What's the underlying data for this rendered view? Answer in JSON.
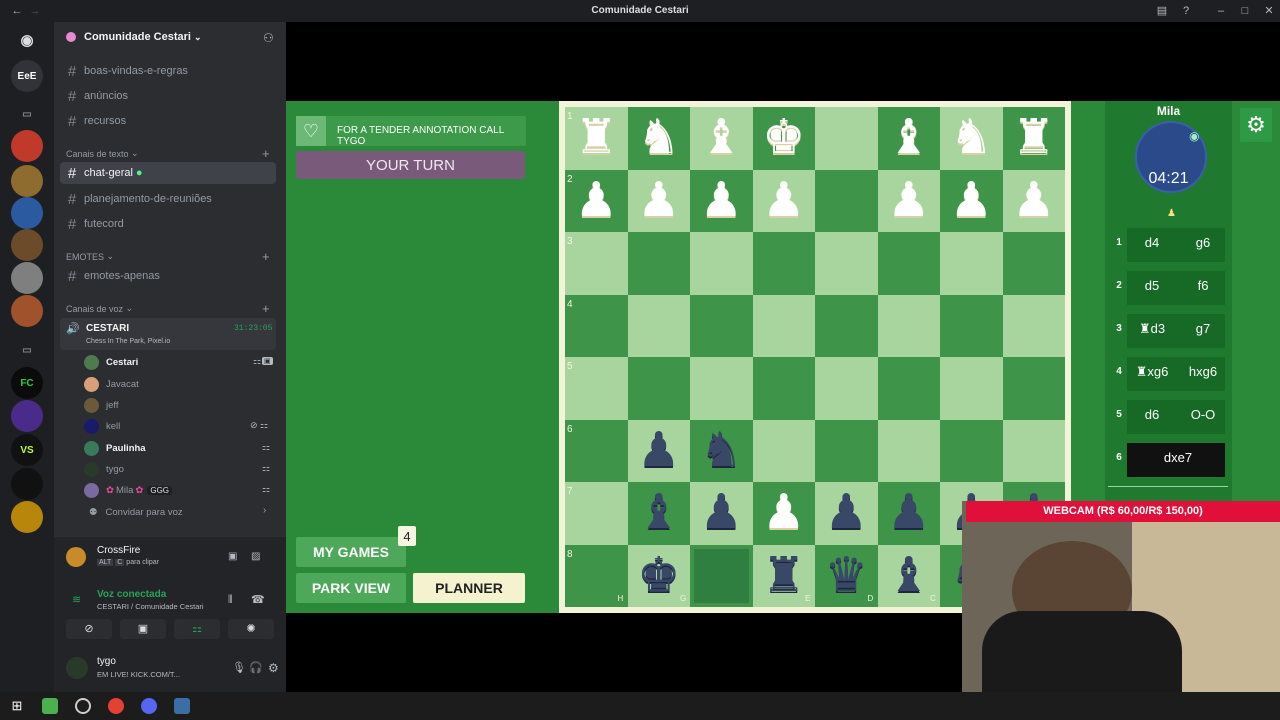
{
  "window": {
    "title": "Comunidade Cestari"
  },
  "rail": {
    "servers": [
      "EeE",
      "FC",
      "VS"
    ]
  },
  "server": {
    "name": "Comunidade Cestari"
  },
  "channels": {
    "top": [
      "boas-vindas-e-regras",
      "anúncios",
      "recursos"
    ],
    "text_category": "Canais de texto",
    "text": [
      "chat-geral",
      "planejamento-de-reuniões",
      "futecord"
    ],
    "emotes_category": "EMOTES",
    "emotes": [
      "emotes-apenas"
    ],
    "voice_category": "Canais de voz",
    "voice_channel": "CESTARI",
    "voice_timer": "31:23:05",
    "voice_activity": "Chess In The Park, Pixel.io",
    "voice_users": [
      "Cestari",
      "Javacat",
      "jeff",
      "kell",
      "Paulinha",
      "tygo",
      "Mila",
      "GGG"
    ],
    "invite": "Convidar para voz"
  },
  "activity": {
    "name": "CrossFire",
    "hint_alt": "ALT",
    "hint_key": "C",
    "hint_text": "para clipar"
  },
  "voice": {
    "status": "Voz conectada",
    "where": "CESTARI / Comunidade Cestari"
  },
  "user": {
    "name": "tygo",
    "status": "EM LIVE! KICK.COM/T..."
  },
  "game": {
    "banner": "FOR A TENDER ANNOTATION CALL TYGO",
    "turn": "YOUR TURN",
    "my_games": "MY GAMES",
    "games_count": "4",
    "park_view": "PARK VIEW",
    "planner": "PLANNER",
    "opponent": "Mila",
    "clock": "04:21",
    "ranks": [
      "1",
      "2",
      "3",
      "4",
      "5",
      "6",
      "7",
      "8"
    ],
    "files": [
      "H",
      "G",
      "F",
      "E",
      "D",
      "C"
    ],
    "moves": [
      {
        "n": "1",
        "w": "d4",
        "b": "g6"
      },
      {
        "n": "2",
        "w": "d5",
        "b": "f6"
      },
      {
        "n": "3",
        "w": "♜d3",
        "b": "g7"
      },
      {
        "n": "4",
        "w": "♜xg6",
        "b": "hxg6"
      },
      {
        "n": "5",
        "w": "d6",
        "b": "O-O"
      },
      {
        "n": "6",
        "w": "dxe7",
        "b": ""
      }
    ]
  },
  "webcam": {
    "label": "WEBCAM (R$ 60,00/R$ 150,00)"
  },
  "colors": {
    "board_light": "#a8d59d",
    "board_dark": "#3e9448",
    "turn_bg": "#7a5a7a",
    "webcam_banner": "#e0103a"
  }
}
